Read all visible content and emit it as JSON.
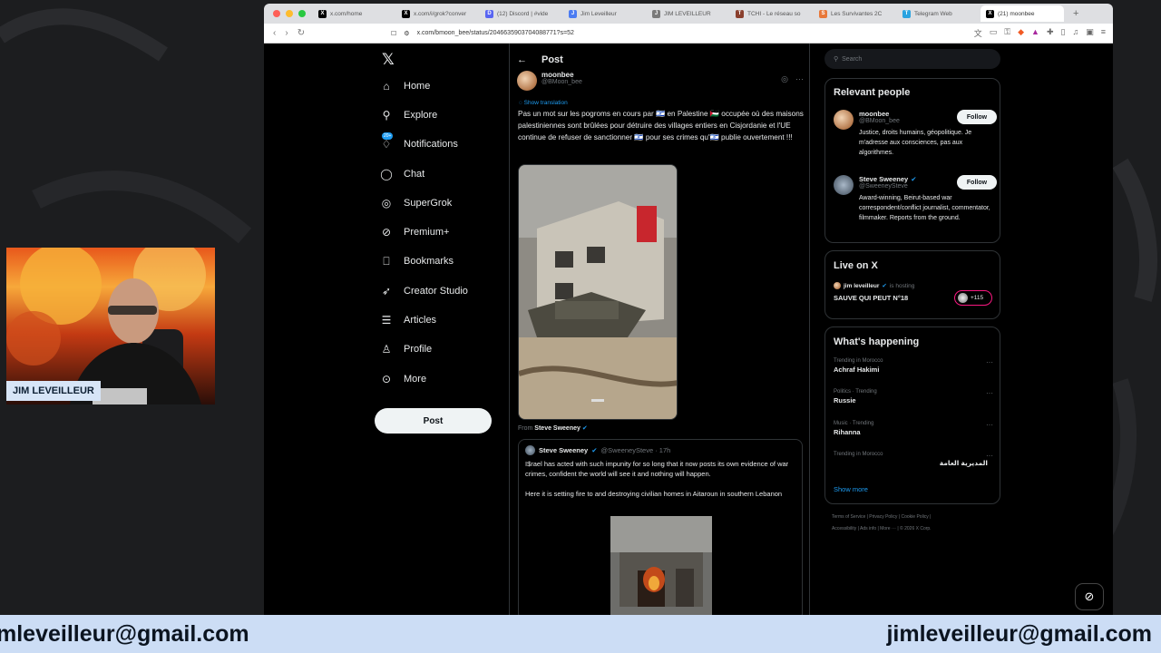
{
  "browser": {
    "tabs": [
      {
        "label": "x.com/home",
        "color": "#000000",
        "glyph": "X"
      },
      {
        "label": "x.com/i/grok?conver",
        "color": "#000000",
        "glyph": "X"
      },
      {
        "label": "(12) Discord | #vide",
        "color": "#5865f2",
        "glyph": "D"
      },
      {
        "label": "Jim Leveilleur",
        "color": "#4c7cf2",
        "glyph": "J"
      },
      {
        "label": "JIM LEVEILLEUR",
        "color": "#7a7a7a",
        "glyph": "J"
      },
      {
        "label": "TCHI - Le réseau so",
        "color": "#8a3f2d",
        "glyph": "T"
      },
      {
        "label": "Les Survivantes 2C",
        "color": "#e8783a",
        "glyph": "S"
      },
      {
        "label": "Telegram Web",
        "color": "#2aa3e0",
        "glyph": "T"
      },
      {
        "label": "(21) moonbee",
        "color": "#000000",
        "glyph": "X",
        "active": true
      }
    ],
    "url": "x.com/bmoon_bee/status/2046635903704088771?s=52"
  },
  "nav": {
    "items": [
      {
        "label": "Home",
        "icon": "home-icon",
        "glyph": "⌂"
      },
      {
        "label": "Explore",
        "icon": "search-icon",
        "glyph": "⚲"
      },
      {
        "label": "Notifications",
        "icon": "bell-icon",
        "glyph": "♢",
        "badge": "20+"
      },
      {
        "label": "Chat",
        "icon": "chat-icon",
        "glyph": "◯"
      },
      {
        "label": "SuperGrok",
        "icon": "grok-icon",
        "glyph": "◎"
      },
      {
        "label": "Premium+",
        "icon": "premium-icon",
        "glyph": "⊘"
      },
      {
        "label": "Bookmarks",
        "icon": "bookmark-icon",
        "glyph": "⎕"
      },
      {
        "label": "Creator Studio",
        "icon": "rocket-icon",
        "glyph": "➶"
      },
      {
        "label": "Articles",
        "icon": "articles-icon",
        "glyph": "☰"
      },
      {
        "label": "Profile",
        "icon": "profile-icon",
        "glyph": "♙"
      },
      {
        "label": "More",
        "icon": "more-icon",
        "glyph": "⊙"
      }
    ],
    "post_button": "Post"
  },
  "post": {
    "header_title": "Post",
    "author_name": "moonbee",
    "author_handle": "@BMoon_bee",
    "show_translation": "Show translation",
    "text": "Pas un mot sur les pogroms en cours par 🇮🇱 en Palestine 🇵🇸 occupée où des maisons palestiniennes sont brûlées pour détruire des villages entiers en Cisjordanie et l'UE continue de refuser de sanctionner 🇮🇱 pour ses crimes qu'🇮🇱 publie ouvertement !!!",
    "from_label": "From",
    "from_name": "Steve Sweeney",
    "quote": {
      "name": "Steve Sweeney",
      "handle": "@SweeneySteve · 17h",
      "text1": "I$rael has acted with such impunity for so long that it now posts its own evidence of war crimes, confident the world will see it and nothing will happen.",
      "text2": "Here it is setting fire to and destroying civilian homes in Aitaroun in southern Lebanon"
    }
  },
  "sidebar": {
    "search_placeholder": "Search",
    "relevant_title": "Relevant people",
    "people": [
      {
        "name": "moonbee",
        "handle": "@BMoon_bee",
        "bio": "Justice, droits humains, géopolitique. Je m'adresse aux consciences, pas aux algorithmes.",
        "follow": "Follow"
      },
      {
        "name": "Steve Sweeney",
        "handle": "@SweeneySteve",
        "bio": "Award-winning, Beirut-based war correspondent/conflict journalist, commentator, filmmaker. Reports from the ground.",
        "follow": "Follow"
      }
    ],
    "live_title": "Live on X",
    "live_host": "jim leveilleur",
    "live_status": "is hosting",
    "live_name": "SAUVE QUI PEUT N°18",
    "live_count": "+115",
    "happening_title": "What's happening",
    "trends": [
      {
        "context": "Trending in Morocco",
        "name": "Achraf Hakimi"
      },
      {
        "context": "Politics · Trending",
        "name": "Russie"
      },
      {
        "context": "Music · Trending",
        "name": "Rihanna"
      },
      {
        "context": "Trending in Morocco",
        "name": "المديرية العامة"
      }
    ],
    "show_more": "Show more",
    "footer_line1": "Terms of Service  |  Privacy Policy  |  Cookie Policy  |",
    "footer_line2": "Accessibility  |  Ads info  |  More ···  |  © 2026 X Corp."
  },
  "overlay": {
    "cam_label": "JIM LEVEILLEUR",
    "email_left": "mleveilleur@gmail.com",
    "email_right": "jimleveilleur@gmail.com"
  },
  "colors": {
    "accent": "#1d9bf0",
    "bottom_bar": "#ccddf5"
  }
}
